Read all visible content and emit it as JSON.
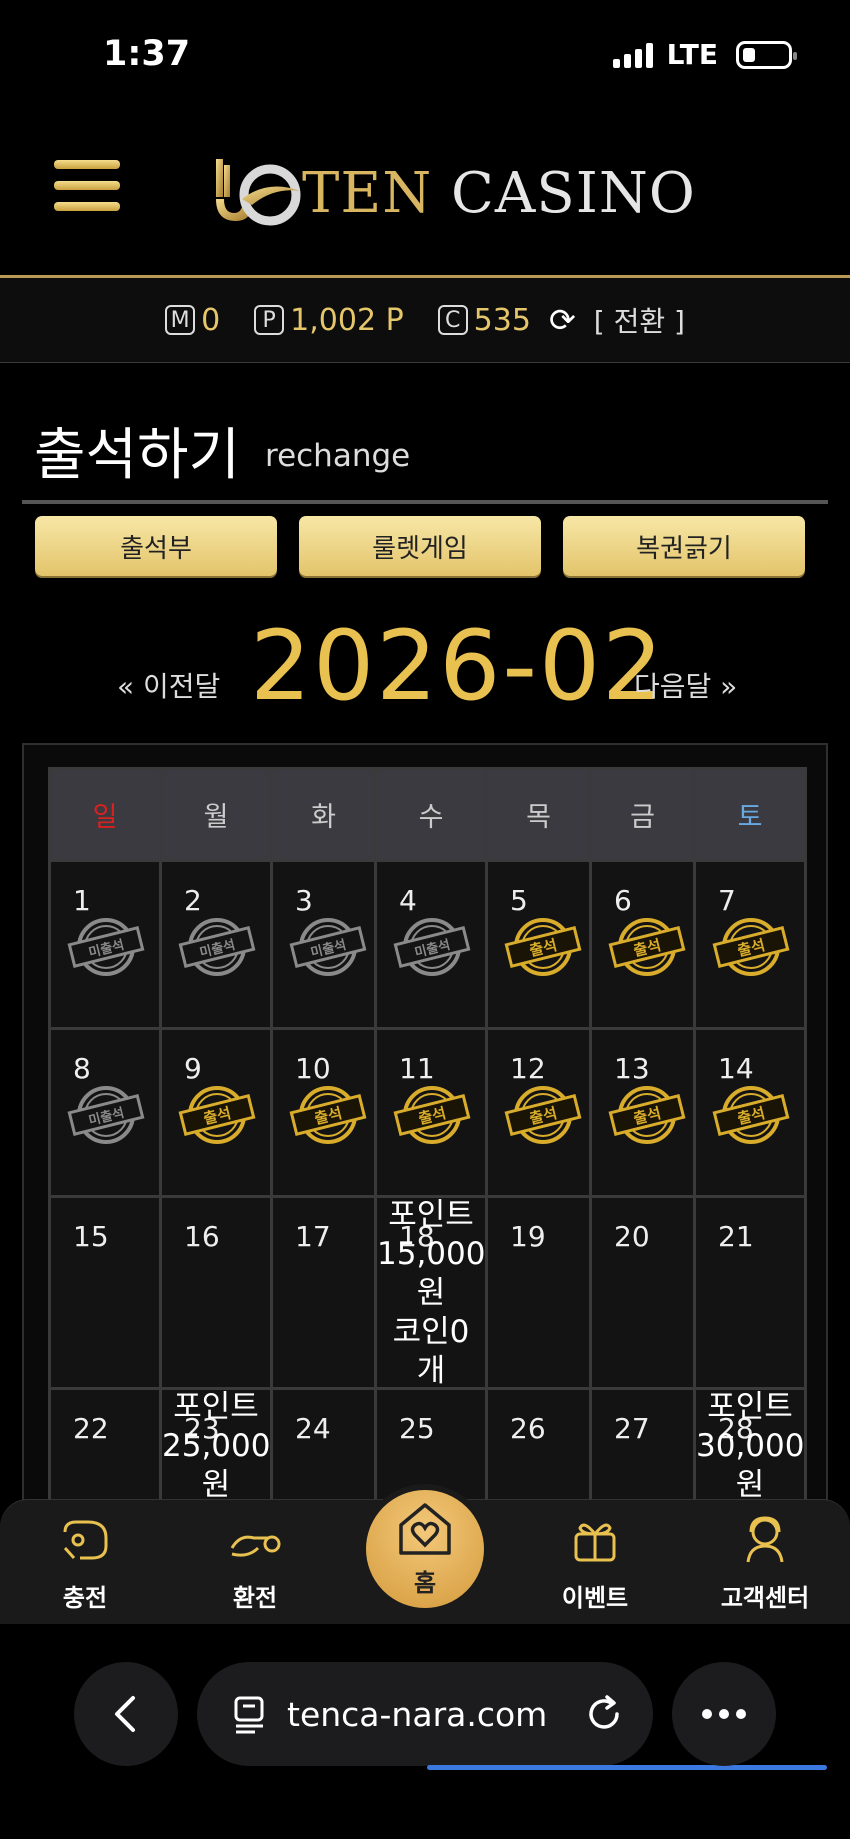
{
  "status_bar": {
    "time": "1:37",
    "network": "LTE"
  },
  "header": {
    "logo_ten": "TEN",
    "logo_casino": "CASINO"
  },
  "balances": {
    "m_label": "M",
    "m_value": "0",
    "p_label": "P",
    "p_value": "1,002 P",
    "c_label": "C",
    "c_value": "535",
    "convert_label": "[ 전환 ]"
  },
  "page": {
    "title": "출석하기",
    "subtitle": "rechange"
  },
  "tabs": [
    "출석부",
    "룰렛게임",
    "복권긁기"
  ],
  "month_nav": {
    "prev": "« 이전달",
    "current": "2026-02",
    "next": "다음달 »"
  },
  "calendar": {
    "weekdays": [
      "일",
      "월",
      "화",
      "수",
      "목",
      "금",
      "토"
    ],
    "stamp_absent": "미출석",
    "stamp_present": "출석",
    "weeks": [
      [
        {
          "day": "1",
          "status": "absent"
        },
        {
          "day": "2",
          "status": "absent"
        },
        {
          "day": "3",
          "status": "absent"
        },
        {
          "day": "4",
          "status": "absent"
        },
        {
          "day": "5",
          "status": "present"
        },
        {
          "day": "6",
          "status": "present"
        },
        {
          "day": "7",
          "status": "present"
        }
      ],
      [
        {
          "day": "8",
          "status": "absent"
        },
        {
          "day": "9",
          "status": "present"
        },
        {
          "day": "10",
          "status": "present"
        },
        {
          "day": "11",
          "status": "present"
        },
        {
          "day": "12",
          "status": "present"
        },
        {
          "day": "13",
          "status": "present"
        },
        {
          "day": "14",
          "status": "present"
        }
      ],
      [
        {
          "day": "15"
        },
        {
          "day": "16"
        },
        {
          "day": "17"
        },
        {
          "day": "18",
          "reward": [
            "포인트",
            "15,000",
            "원",
            "코인0",
            "개"
          ]
        },
        {
          "day": "19"
        },
        {
          "day": "20"
        },
        {
          "day": "21"
        }
      ],
      [
        {
          "day": "22"
        },
        {
          "day": "23",
          "reward": [
            "포인트",
            "25,000",
            "원"
          ]
        },
        {
          "day": "24"
        },
        {
          "day": "25"
        },
        {
          "day": "26"
        },
        {
          "day": "27"
        },
        {
          "day": "28",
          "reward": [
            "포인트",
            "30,000",
            "원"
          ]
        }
      ]
    ]
  },
  "bottom_nav": {
    "charge": "충전",
    "exchange": "환전",
    "home": "홈",
    "event": "이벤트",
    "support": "고객센터"
  },
  "browser": {
    "url": "tenca-nara.com"
  },
  "colors": {
    "gold": "#e8c150",
    "gold_button": "#ecd184",
    "background": "#000000",
    "sunday": "#d9221f",
    "saturday": "#6aa8e0"
  }
}
